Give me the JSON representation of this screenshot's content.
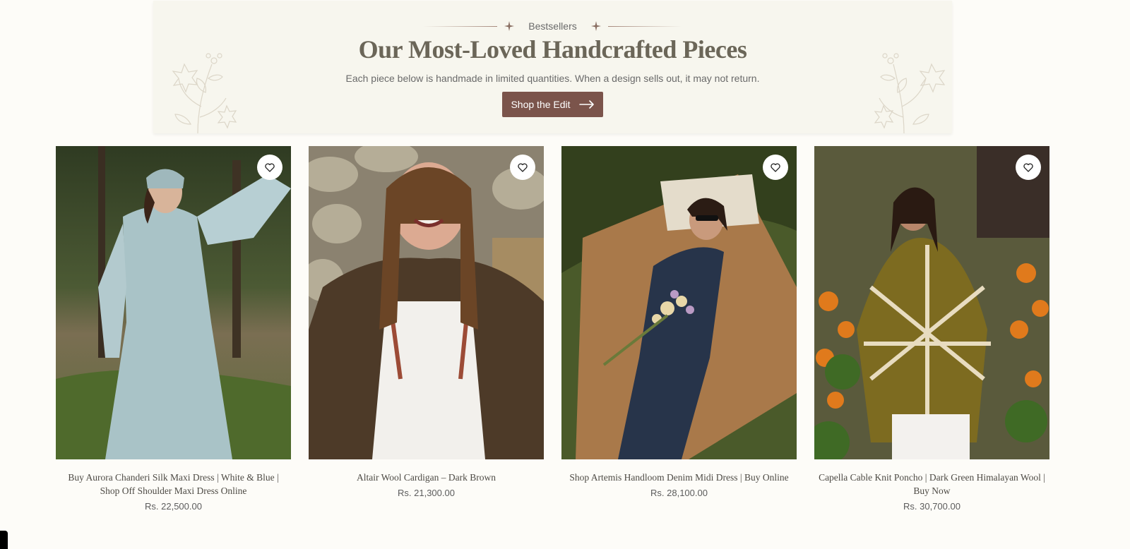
{
  "banner": {
    "eyebrow": "Bestsellers",
    "title": "Our Most-Loved Handcrafted Pieces",
    "subtitle": "Each piece below is handmade in limited quantities. When a design sells out, it may not return.",
    "cta_label": "Shop the Edit"
  },
  "products": [
    {
      "title": "Buy Aurora Chanderi Silk Maxi Dress | White & Blue | Shop Off Shoulder Maxi Dress Online",
      "price": "Rs. 22,500.00"
    },
    {
      "title": "Altair Wool Cardigan – Dark Brown",
      "price": "Rs. 21,300.00"
    },
    {
      "title": "Shop Artemis Handloom Denim Midi Dress | Buy Online",
      "price": "Rs. 28,100.00"
    },
    {
      "title": "Capella Cable Knit Poncho | Dark Green Himalayan Wool | Buy Now",
      "price": "Rs. 30,700.00"
    }
  ],
  "colors": {
    "accent": "#7b544b",
    "banner_bg": "#f7f6ee",
    "page_bg": "#fdfcf8",
    "title": "#6b6658"
  },
  "icons": {
    "wishlist": "heart-icon",
    "cta": "arrow-right-icon",
    "eyebrow": "sparkle-icon",
    "decor": "floral-icon"
  }
}
